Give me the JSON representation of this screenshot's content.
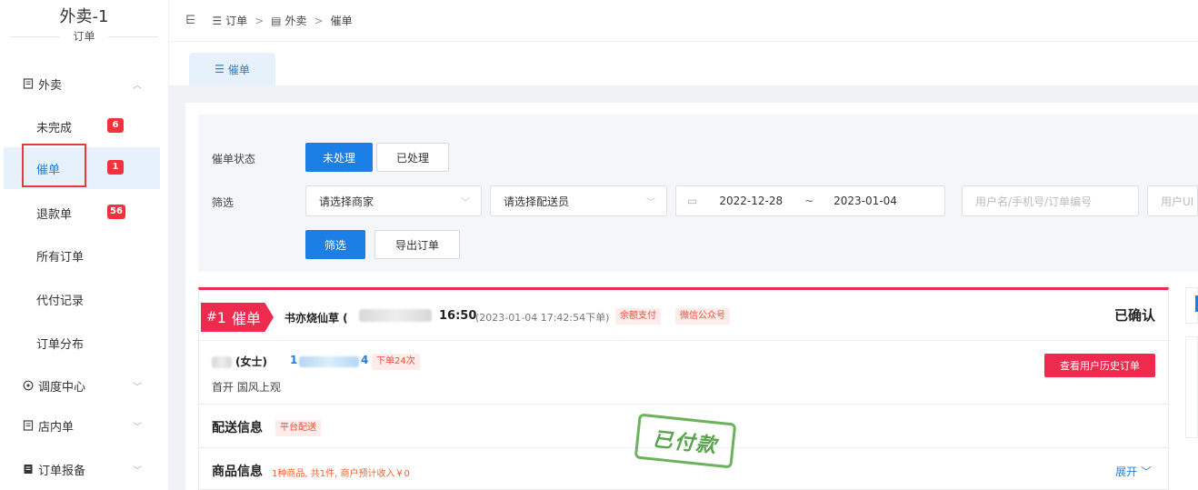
{
  "sidebar": {
    "brand_title": "外卖-1",
    "brand_sub": "订单",
    "groups": [
      {
        "label": "外卖",
        "icon": "document-icon",
        "chevron": "^"
      },
      {
        "label": "调度中心",
        "icon": "location-icon",
        "chevron": "v"
      },
      {
        "label": "店内单",
        "icon": "document-icon",
        "chevron": "v"
      },
      {
        "label": "订单报备",
        "icon": "document-filled-icon",
        "chevron": "v"
      }
    ],
    "items": [
      {
        "label": "未完成",
        "count": "6"
      },
      {
        "label": "催单",
        "count": "1",
        "active": true
      },
      {
        "label": "退款单",
        "count": "56"
      },
      {
        "label": "所有订单"
      },
      {
        "label": "代付记录"
      },
      {
        "label": "订单分布"
      }
    ]
  },
  "topbar": {
    "breadcrumb": [
      "订单",
      "外卖",
      "催单"
    ]
  },
  "tabs": [
    {
      "label": "催单"
    }
  ],
  "filters": {
    "status_label": "催单状态",
    "status_options": [
      "未处理",
      "已处理"
    ],
    "filter_label": "筛选",
    "merchant_placeholder": "请选择商家",
    "courier_placeholder": "请选择配送员",
    "date_start": "2022-12-28",
    "date_sep": "~",
    "date_end": "2023-01-04",
    "search_placeholder": "用户名/手机号/订单编号",
    "uid_placeholder": "用户UI",
    "filter_button": "筛选",
    "export_button": "导出订单"
  },
  "order": {
    "hash": "#",
    "number": "1",
    "label": "催单",
    "shop_name": "书亦烧仙草 (",
    "time_main": "16:50",
    "time_detail": "(2023-01-04 17:42:54下单)",
    "tags": [
      "余额支付",
      "微信公众号"
    ],
    "status": "已确认",
    "customer_name": "(女士)",
    "customer_phone_prefix": "1",
    "customer_phone_suffix": "4",
    "order_count_tag": "下单24次",
    "address": "首开 国风上观",
    "history_button": "查看用户历史订单",
    "delivery_title": "配送信息",
    "delivery_tag": "平台配送",
    "goods_title": "商品信息",
    "goods_summary": "1种商品, 共1件, 商户预计收入￥0",
    "expand_label": "展开",
    "paid_stamp": "已付款"
  },
  "colors": {
    "primary": "#1b7fe6",
    "danger": "#ee2a4e",
    "badge": "#f1323d",
    "stamp": "#4a9b3b"
  }
}
